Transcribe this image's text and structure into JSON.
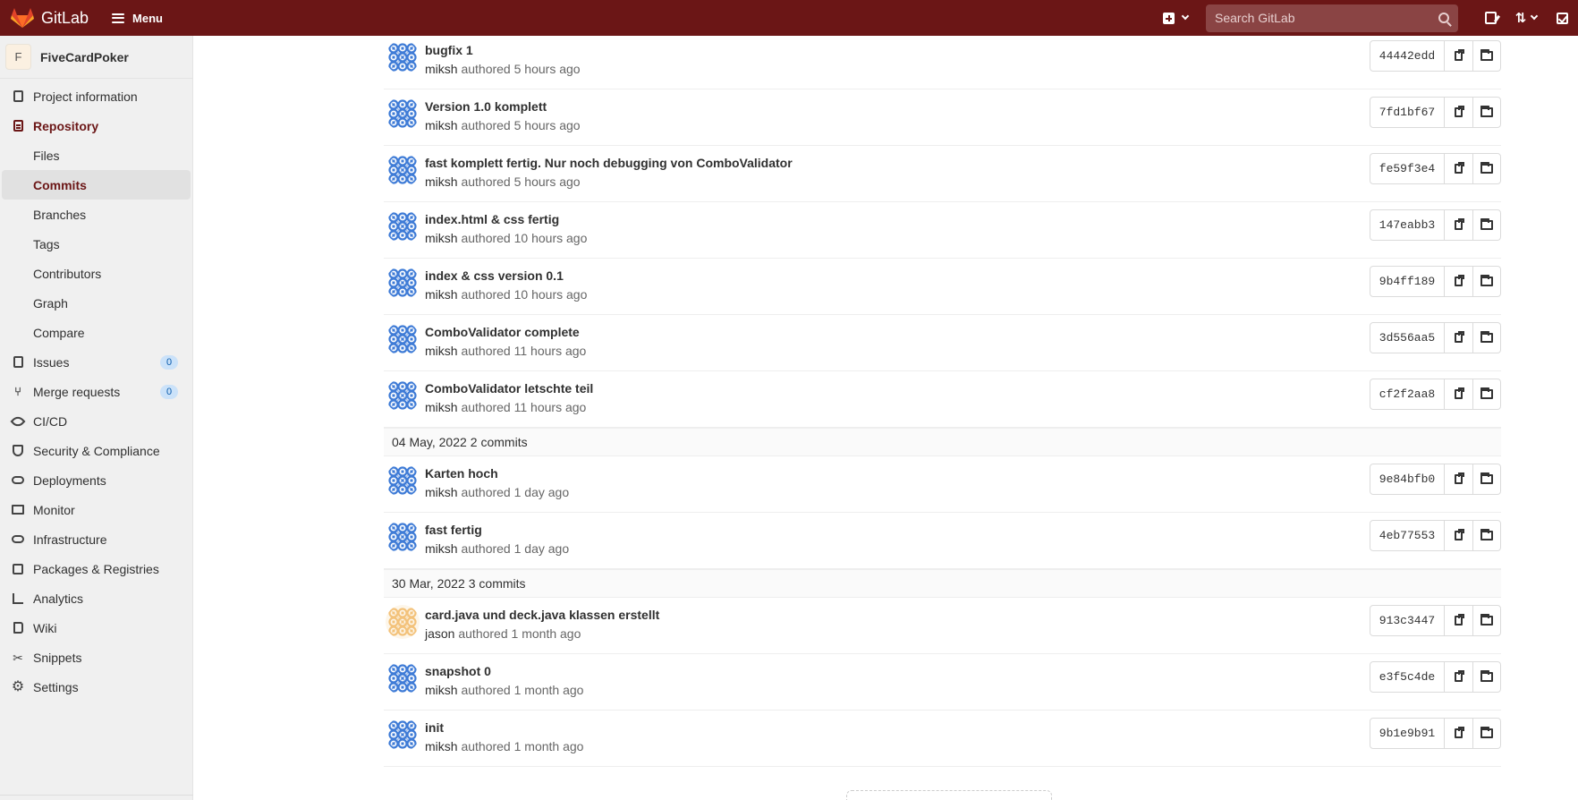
{
  "navbar": {
    "brand": "GitLab",
    "menu_label": "Menu",
    "search_placeholder": "Search GitLab",
    "colors": {
      "navbar_bg": "#6b1616",
      "accent": "#6b1616"
    }
  },
  "sidebar": {
    "project_initial": "F",
    "project_name": "FiveCardPoker",
    "items": [
      {
        "label": "Project information",
        "icon": "project-info-icon"
      },
      {
        "label": "Repository",
        "icon": "repository-icon"
      },
      {
        "label": "Files"
      },
      {
        "label": "Commits"
      },
      {
        "label": "Branches"
      },
      {
        "label": "Tags"
      },
      {
        "label": "Contributors"
      },
      {
        "label": "Graph"
      },
      {
        "label": "Compare"
      },
      {
        "label": "Issues",
        "icon": "issues-icon",
        "badge": "0"
      },
      {
        "label": "Merge requests",
        "icon": "merge-request-icon",
        "badge": "0"
      },
      {
        "label": "CI/CD",
        "icon": "rocket-icon"
      },
      {
        "label": "Security & Compliance",
        "icon": "shield-icon"
      },
      {
        "label": "Deployments",
        "icon": "cloud-icon"
      },
      {
        "label": "Monitor",
        "icon": "monitor-icon"
      },
      {
        "label": "Infrastructure",
        "icon": "infrastructure-icon"
      },
      {
        "label": "Packages & Registries",
        "icon": "package-icon"
      },
      {
        "label": "Analytics",
        "icon": "chart-icon"
      },
      {
        "label": "Wiki",
        "icon": "book-icon"
      },
      {
        "label": "Snippets",
        "icon": "scissors-icon"
      },
      {
        "label": "Settings",
        "icon": "gear-icon"
      }
    ]
  },
  "commits": {
    "group_today": [
      {
        "title": "bugfix 1",
        "author": "miksh",
        "verb": "authored",
        "time": "5 hours ago",
        "sha": "44442edd"
      },
      {
        "title": "Version 1.0 komplett",
        "author": "miksh",
        "verb": "authored",
        "time": "5 hours ago",
        "sha": "7fd1bf67"
      },
      {
        "title": "fast komplett fertig. Nur noch debugging von ComboValidator",
        "author": "miksh",
        "verb": "authored",
        "time": "5 hours ago",
        "sha": "fe59f3e4"
      },
      {
        "title": "index.html & css fertig",
        "author": "miksh",
        "verb": "authored",
        "time": "10 hours ago",
        "sha": "147eabb3"
      },
      {
        "title": "index & css version 0.1",
        "author": "miksh",
        "verb": "authored",
        "time": "10 hours ago",
        "sha": "9b4ff189"
      },
      {
        "title": "ComboValidator complete",
        "author": "miksh",
        "verb": "authored",
        "time": "11 hours ago",
        "sha": "3d556aa5"
      },
      {
        "title": "ComboValidator letschte teil",
        "author": "miksh",
        "verb": "authored",
        "time": "11 hours ago",
        "sha": "cf2f2aa8"
      }
    ],
    "day2": {
      "date": "04 May, 2022",
      "count": "2 commits"
    },
    "group_may04": [
      {
        "title": "Karten hoch",
        "author": "miksh",
        "verb": "authored",
        "time": "1 day ago",
        "sha": "9e84bfb0"
      },
      {
        "title": "fast fertig",
        "author": "miksh",
        "verb": "authored",
        "time": "1 day ago",
        "sha": "4eb77553"
      }
    ],
    "day3": {
      "date": "30 Mar, 2022",
      "count": "3 commits"
    },
    "group_mar30": [
      {
        "title": "card.java und deck.java klassen erstellt",
        "author": "jason",
        "verb": "authored",
        "time": "1 month ago",
        "sha": "913c3447"
      },
      {
        "title": "snapshot 0",
        "author": "miksh",
        "verb": "authored",
        "time": "1 month ago",
        "sha": "e3f5c4de"
      },
      {
        "title": "init",
        "author": "miksh",
        "verb": "authored",
        "time": "1 month ago",
        "sha": "9b1e9b91"
      }
    ]
  }
}
